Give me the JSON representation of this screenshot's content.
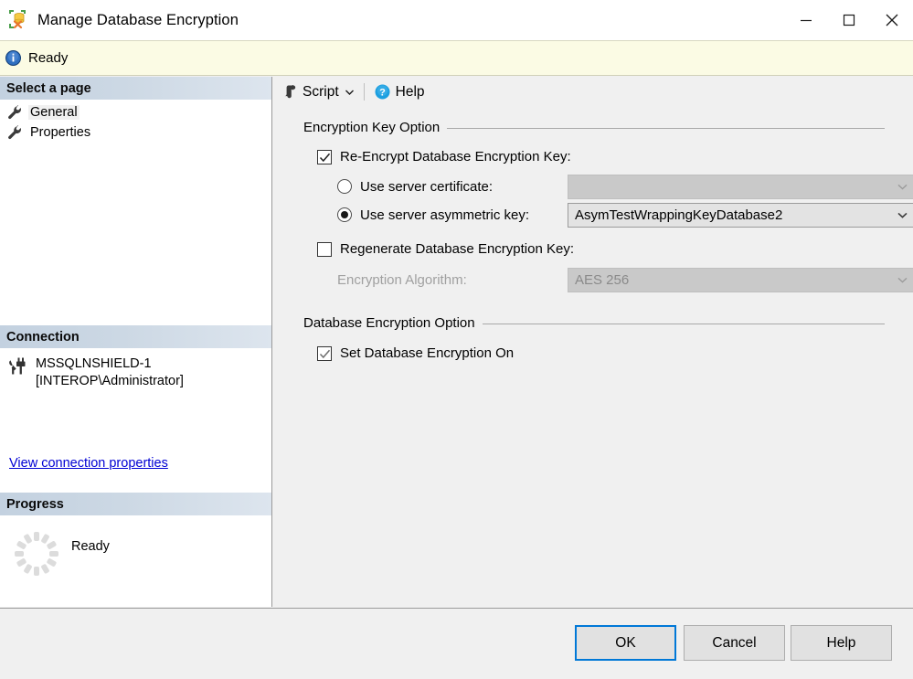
{
  "window": {
    "title": "Manage Database Encryption",
    "icon": "database-encryption-icon",
    "controls": {
      "minimize": "minimize-icon",
      "maximize": "maximize-icon",
      "close": "close-icon"
    }
  },
  "status": {
    "icon": "info-icon",
    "text": "Ready"
  },
  "sidebar": {
    "select_page": {
      "header": "Select a page",
      "items": [
        {
          "label": "General",
          "icon": "wrench-icon",
          "selected": true
        },
        {
          "label": "Properties",
          "icon": "wrench-icon",
          "selected": false
        }
      ]
    },
    "connection": {
      "header": "Connection",
      "icon": "connection-plug-icon",
      "server": "MSSQLNSHIELD-1",
      "user": "[INTEROP\\Administrator]",
      "link": "View connection properties"
    },
    "progress": {
      "header": "Progress",
      "icon": "spinner-icon",
      "text": "Ready"
    }
  },
  "toolbar": {
    "script_label": "Script",
    "script_icon": "script-icon",
    "script_caret": "chevron-down-icon",
    "help_label": "Help",
    "help_icon": "help-circle-icon"
  },
  "main": {
    "encryption_key_option": {
      "title": "Encryption Key Option",
      "reencrypt": {
        "label": "Re-Encrypt Database Encryption Key:",
        "checked": true
      },
      "use_server_certificate": {
        "label": "Use server certificate:",
        "selected": false,
        "combo_value": "",
        "combo_enabled": false,
        "caret": "chevron-down-icon"
      },
      "use_server_asymmetric_key": {
        "label": "Use server asymmetric key:",
        "selected": true,
        "combo_value": "AsymTestWrappingKeyDatabase2",
        "combo_enabled": true,
        "caret": "chevron-down-icon"
      },
      "regenerate": {
        "label": "Regenerate Database Encryption Key:",
        "checked": false
      },
      "encryption_algorithm": {
        "label": "Encryption Algorithm:",
        "combo_value": "AES 256",
        "combo_enabled": false,
        "caret": "chevron-down-icon"
      }
    },
    "database_encryption_option": {
      "title": "Database Encryption Option",
      "set_encryption_on": {
        "label": "Set Database Encryption On",
        "checked": true
      }
    }
  },
  "footer": {
    "ok": "OK",
    "cancel": "Cancel",
    "help": "Help"
  },
  "colors": {
    "accent": "#0078d7",
    "link": "#0000d4",
    "status_bar": "#fbfbe4",
    "panel_header_start": "#c3d1e0",
    "panel_header_end": "#dde5ee",
    "dialog_bg": "#f0f0f0",
    "combo_enabled_bg": "#e3e3e3",
    "combo_disabled_bg": "#c9c9c9",
    "disabled_text": "#a0a0a0"
  }
}
